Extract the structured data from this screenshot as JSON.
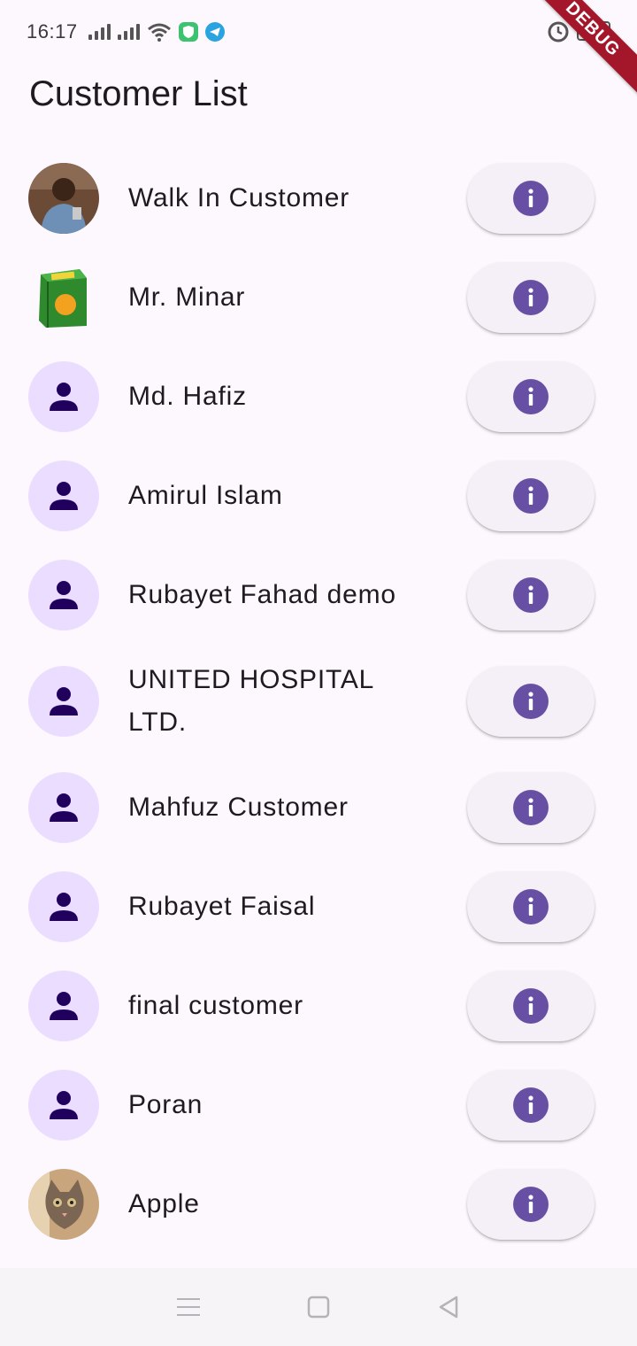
{
  "status_bar": {
    "time": "16:17",
    "debug_label": "DEBUG"
  },
  "page": {
    "title": "Customer List"
  },
  "customers": [
    {
      "name": "Walk In Customer",
      "avatar": "photo-man"
    },
    {
      "name": "Mr. Minar",
      "avatar": "product-box"
    },
    {
      "name": "Md. Hafiz",
      "avatar": "person-icon"
    },
    {
      "name": "Amirul Islam",
      "avatar": "person-icon"
    },
    {
      "name": "Rubayet Fahad demo",
      "avatar": "person-icon"
    },
    {
      "name": "UNITED HOSPITAL LTD.",
      "avatar": "person-icon"
    },
    {
      "name": "Mahfuz Customer",
      "avatar": "person-icon"
    },
    {
      "name": "Rubayet Faisal",
      "avatar": "person-icon"
    },
    {
      "name": "final customer",
      "avatar": "person-icon"
    },
    {
      "name": "Poran",
      "avatar": "person-icon"
    },
    {
      "name": "Apple",
      "avatar": "photo-cat"
    }
  ],
  "colors": {
    "background": "#fdf8fd",
    "avatar_bg": "#eaddff",
    "avatar_icon": "#21005d",
    "info_button_bg": "#f5f0f8",
    "info_icon": "#6750a4",
    "debug_ribbon": "#a4162a"
  }
}
